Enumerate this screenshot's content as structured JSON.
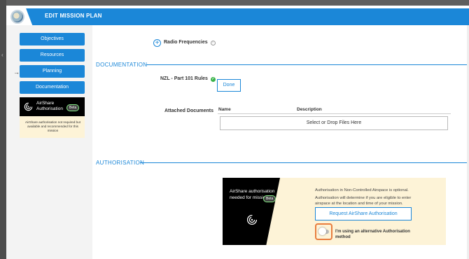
{
  "header": {
    "title": "EDIT MISSION PLAN"
  },
  "sidebar": {
    "items": [
      {
        "label": "Objectives"
      },
      {
        "label": "Resources"
      },
      {
        "label": "Planning"
      },
      {
        "label": "Documentation"
      }
    ],
    "active_indicator": "→",
    "airshare_card": {
      "title_line1": "AirShare",
      "title_line2": "Authorisation",
      "badge": "Beta",
      "note": "AirShare authorisation not required but available and recommended for this mission"
    }
  },
  "main": {
    "radio_frequencies": {
      "label": "Radio Frequencies",
      "info": "i",
      "add_icon": "+"
    },
    "documentation": {
      "section_title": "DOCUMENTATION",
      "rule_label": "NZL - Part 101 Rules",
      "rule_status": "✓",
      "done_label": "Done",
      "attached_label": "Attached Documents",
      "columns": [
        "Name",
        "Description"
      ],
      "dropzone_text": "Select or Drop Files Here"
    },
    "authorisation": {
      "section_title": "AUTHORISATION",
      "panel_title_line1": "AirShare authorisation",
      "panel_title_line2": "needed for mission",
      "badge": "Beta",
      "info_line1": "Authorisation in Non-Controlled Airspace is optional.",
      "info_line2": "Authorisation will determine if you are eligible to enter airspace at the location and time of your mission.",
      "request_button": "Request AirShare Authorisation",
      "toggle_label": "I'm using an alternative Authorisation method",
      "toggle_on": false
    }
  },
  "colors": {
    "accent": "#1b87d8",
    "panel_bg": "#fdf3d7",
    "highlight": "#e87d3e"
  }
}
